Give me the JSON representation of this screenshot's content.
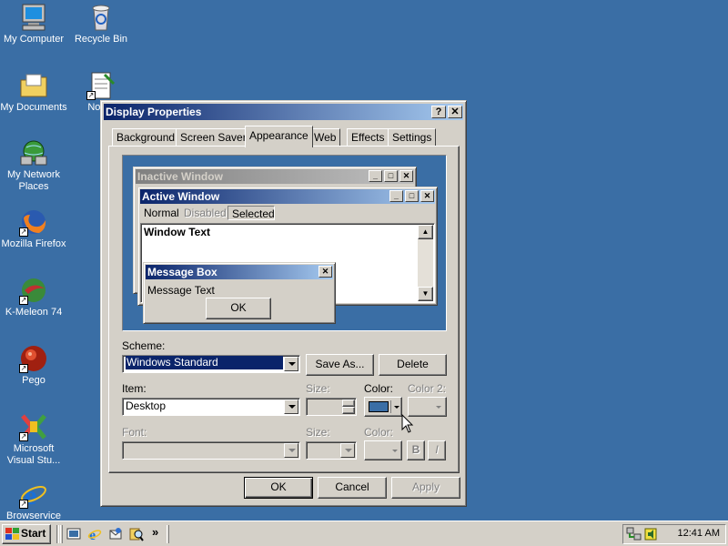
{
  "desktop": {
    "background": "#3a6ea5",
    "icons": [
      {
        "label": "My Computer",
        "icon": "computer-icon"
      },
      {
        "label": "Recycle Bin",
        "icon": "recycle-bin-icon"
      },
      {
        "label": "My Documents",
        "icon": "folder-icon"
      },
      {
        "label": "Notep",
        "icon": "notepad-icon"
      },
      {
        "label": "My Network Places",
        "icon": "network-icon"
      },
      {
        "label": "Mozilla Firefox",
        "icon": "firefox-icon"
      },
      {
        "label": "K-Meleon 74",
        "icon": "kmeleon-icon"
      },
      {
        "label": "Pego",
        "icon": "pego-icon"
      },
      {
        "label": "Microsoft Visual Stu...",
        "icon": "visual-studio-icon"
      },
      {
        "label": "Browservice",
        "icon": "ie-icon"
      }
    ]
  },
  "dialog": {
    "title": "Display Properties",
    "help_button": "?",
    "close_button": "✕",
    "tabs": [
      {
        "label": "Background",
        "active": false
      },
      {
        "label": "Screen Saver",
        "active": false
      },
      {
        "label": "Appearance",
        "active": true
      },
      {
        "label": "Web",
        "active": false
      },
      {
        "label": "Effects",
        "active": false
      },
      {
        "label": "Settings",
        "active": false
      }
    ],
    "preview": {
      "inactive_window": "Inactive Window",
      "active_window": "Active Window",
      "menu": {
        "normal": "Normal",
        "disabled": "Disabled",
        "selected": "Selected"
      },
      "window_text": "Window Text",
      "message_box": {
        "title": "Message Box",
        "text": "Message Text",
        "ok": "OK"
      }
    },
    "scheme": {
      "label": "Scheme:",
      "value": "Windows Standard",
      "save_as": "Save As...",
      "delete": "Delete"
    },
    "item": {
      "label": "Item:",
      "value": "Desktop",
      "size_label": "Size:",
      "color_label": "Color:",
      "color2_label": "Color 2:",
      "color_value": "#3a6ea5"
    },
    "font": {
      "label": "Font:",
      "size_label": "Size:",
      "color_label": "Color:",
      "bold": "B",
      "italic": "I"
    },
    "buttons": {
      "ok": "OK",
      "cancel": "Cancel",
      "apply": "Apply"
    }
  },
  "taskbar": {
    "start": "Start",
    "chevron": "»",
    "clock": "12:41 AM"
  }
}
